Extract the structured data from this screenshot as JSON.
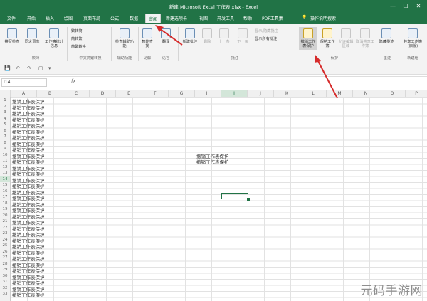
{
  "window": {
    "title": "新建 Microsoft Excel 工作表.xlsx - Excel",
    "controls": [
      "—",
      "☐",
      "✕"
    ]
  },
  "tabs": [
    "文件",
    "开始",
    "插入",
    "绘图",
    "页面布局",
    "公式",
    "数据",
    "审阅",
    "新建选项卡",
    "视图",
    "开发工具",
    "帮助",
    "PDF工具集"
  ],
  "active_tab": "审阅",
  "tell_me": "操作说明搜索",
  "ribbon": {
    "proofing": {
      "spelling": "拼写检查",
      "thesaurus": "同义词库",
      "stats": "工作簿统计信息",
      "group": "校对"
    },
    "chinese": {
      "to_trad": "繁转简",
      "to_simp": "简转繁",
      "convert": "简繁转换",
      "group": "中文简繁转换"
    },
    "accessibility": {
      "check": "检查辅助功能",
      "group": "辅助功能"
    },
    "insights": {
      "smart": "智能查找",
      "group": "见解"
    },
    "language": {
      "translate": "翻译",
      "group": "语言"
    },
    "comments": {
      "new": "新建批注",
      "delete": "删除",
      "prev": "上一条",
      "next": "下一条",
      "show_hide": "显示/隐藏批注",
      "show_all": "显示所有批注",
      "group": "批注"
    },
    "protect": {
      "unprotect_sheet": "撤消工作表保护",
      "protect_book": "保护工作簿",
      "allow_edit": "允许编辑区域",
      "unshare": "取消共享工作簿",
      "group": "保护"
    },
    "ink": {
      "hide": "隐藏墨迹",
      "group": "墨迹"
    },
    "share": {
      "share_book": "共享工作簿(旧版)",
      "group": "新建组"
    }
  },
  "qat": [
    "💾",
    "↶",
    "↷",
    "▢",
    "▾"
  ],
  "name_box": "I14",
  "fx": "fx",
  "columns": [
    "A",
    "B",
    "C",
    "D",
    "E",
    "F",
    "G",
    "H",
    "I",
    "J",
    "K",
    "L",
    "M",
    "N",
    "O",
    "P"
  ],
  "selected_column": "I",
  "rows": [
    "1",
    "2",
    "3",
    "4",
    "5",
    "6",
    "7",
    "8",
    "9",
    "10",
    "11",
    "12",
    "13",
    "14",
    "15",
    "16",
    "17",
    "18",
    "19",
    "20",
    "21",
    "22",
    "23",
    "24",
    "25",
    "26",
    "27",
    "28",
    "29",
    "30",
    "31",
    "32",
    "33"
  ],
  "selected_row": "14",
  "cell_text": "撤销工作表保护",
  "h_cells": [
    {
      "row": "10",
      "text": "撤销工作表保护"
    },
    {
      "row": "11",
      "text": "撤销工作表保护"
    }
  ],
  "watermark": "元码手游网",
  "colors": {
    "excel_green": "#217346",
    "annotation_red": "#d62b2b"
  }
}
